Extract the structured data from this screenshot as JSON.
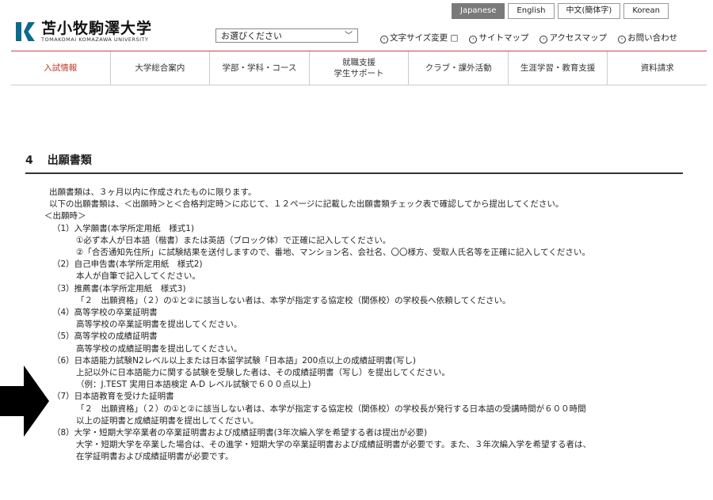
{
  "lang": [
    "Japanese",
    "English",
    "中文(簡体字)",
    "Korean"
  ],
  "logo": {
    "jp": "苫小牧駒澤大学",
    "en": "TOMAKOMAI KOMAZAWA UNIVERSITY"
  },
  "select": {
    "value": "お選びください"
  },
  "util": [
    "文字サイズ変更",
    "サイトマップ",
    "アクセスマップ",
    "お問い合わせ"
  ],
  "nav": [
    "入試情報",
    "大学総合案内",
    "学部・学科・コース",
    "就職支援\n学生サポート",
    "クラブ・課外活動",
    "生涯学習・教育支援",
    "資料請求"
  ],
  "section": {
    "num": "4",
    "title": "出願書類"
  },
  "lines": [
    "出願書類は、３ヶ月以内に作成されたものに限ります。",
    "以下の出願書類は、＜出願時＞と＜合格判定時＞に応じて、１２ページに記載した出願書類チェック表で確認してから提出してください。",
    "＜出願時＞",
    "（1）入学願書(本学所定用紙　様式1)",
    "①必ず本人が日本語（楷書）または英語（ブロック体）で正確に記入してください。",
    "②「合否通知先住所」に試験結果を送付しますので、番地、マンション名、会社名、〇〇様方、受取人氏名等を正確に記入してください。",
    "（2）自己申告書(本学所定用紙　様式2)",
    "本人が自筆で記入してください。",
    "（3）推薦書(本学所定用紙　様式3)",
    "「２　出願資格」（２）の①と②に該当しない者は、本学が指定する協定校（関係校）の学校長へ依頼してください。",
    "（4）高等学校の卒業証明書",
    "高等学校の卒業証明書を提出してください。",
    "（5）高等学校の成績証明書",
    "高等学校の成績証明書を提出してください。",
    "（6）日本語能力試験N2レベル以上または日本留学試験「日本語」200点以上の成績証明書(写し)",
    "上記以外に日本語能力に関する試験を受験した者は、その成績証明書（写し）を提出してください。",
    "（例：J.TEST 実用日本語検定 A-D レベル試験で６００点以上)",
    "（7）日本語教育を受けた証明書",
    "「２　出願資格」（２）の①と②に該当しない者は、本学が指定する協定校（関係校）の学校長が発行する日本語の受講時間が６００時間",
    "以上の証明書と成績証明書を提出してください。",
    "（8）大学・短期大学卒業者の卒業証明書および成績証明書(3年次編入学を希望する者は提出が必要)",
    "大学・短期大学を卒業した場合は、その進学・短期大学の卒業証明書および成績証明書が必要です。また、３年次編入学を希望する者は、",
    "在学証明書および成績証明書が必要です。"
  ]
}
